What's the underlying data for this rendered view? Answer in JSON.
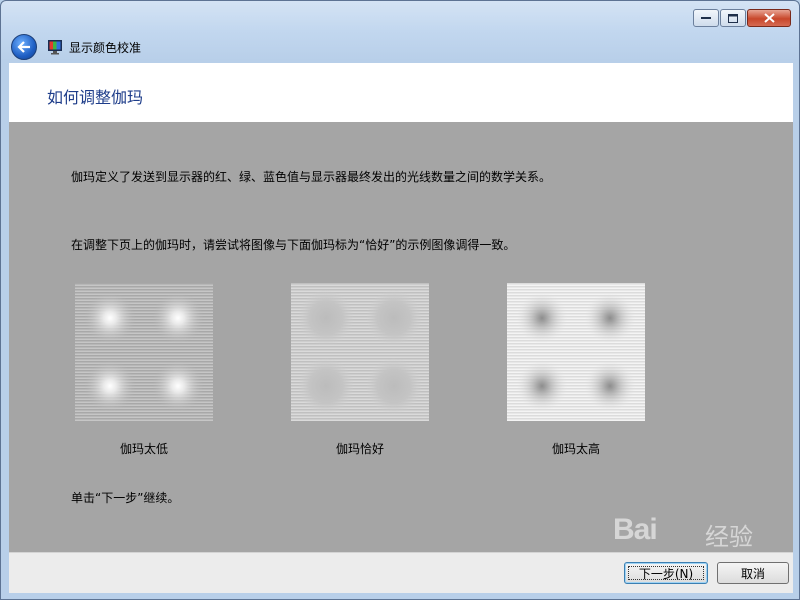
{
  "window": {
    "title": "显示颜色校准",
    "controls": [
      "minimize",
      "maximize",
      "close"
    ]
  },
  "header": {
    "title": "如何调整伽玛"
  },
  "content": {
    "paragraph1": "伽玛定义了发送到显示器的红、绿、蓝色值与显示器最终发出的光线数量之间的数学关系。",
    "paragraph2": "在调整下页上的伽玛时，请尝试将图像与下面伽玛标为“恰好”的示例图像调得一致。",
    "samples": [
      {
        "caption": "伽玛太低",
        "variant": "low"
      },
      {
        "caption": "伽玛恰好",
        "variant": "good"
      },
      {
        "caption": "伽玛太高",
        "variant": "high"
      }
    ],
    "instruction": "单击“下一步”继续。"
  },
  "footer": {
    "next_label": "下一步(N)",
    "cancel_label": "取消"
  },
  "watermark": {
    "text": "Bai",
    "sub": "经验"
  },
  "colors": {
    "content_bg": "#a5a5a5",
    "title_color": "#1e3d8a",
    "close_red": "#c8472b"
  }
}
